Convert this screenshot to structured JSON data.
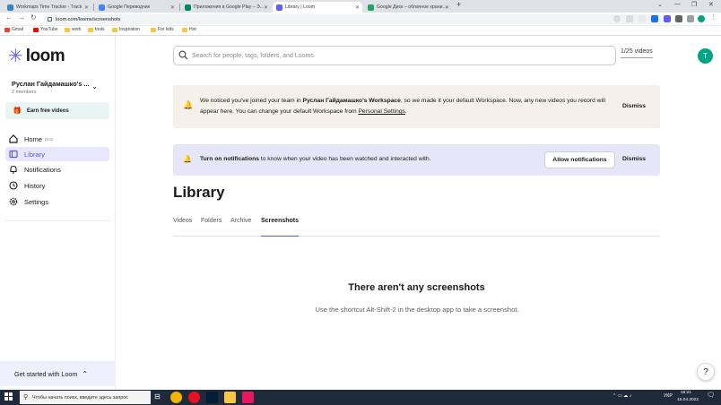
{
  "browser": {
    "tabs": [
      {
        "title": "Workmaps Time Tracker - Track",
        "color": "#3b82c4"
      },
      {
        "title": "Google Переводчик",
        "color": "#4285f4"
      },
      {
        "title": "Приложения в Google Play – Э...",
        "color": "#01875f"
      },
      {
        "title": "Library | Loom",
        "color": "#625df5"
      },
      {
        "title": "Google Диск – облачное храни...",
        "color": "#1fa463"
      }
    ],
    "new_tab": "+",
    "url": "loom.com/looms/screenshots",
    "bookmarks": [
      "Gmail",
      "YouTube",
      "work",
      "tools",
      "Inspiration",
      "For kids",
      "Hot"
    ]
  },
  "sidebar": {
    "logo_text": "loom",
    "workspace_name": "Руслан Гайдамашко's ...",
    "workspace_members": "2 members",
    "earn_label": "Earn free videos",
    "nav": [
      {
        "label": "Home",
        "badge": "Beta",
        "icon": "home-icon"
      },
      {
        "label": "Library",
        "icon": "library-icon",
        "active": true
      },
      {
        "label": "Notifications",
        "icon": "bell-icon"
      },
      {
        "label": "History",
        "icon": "clock-icon"
      },
      {
        "label": "Settings",
        "icon": "gear-icon"
      }
    ],
    "get_started": "Get started with Loom"
  },
  "header": {
    "search_placeholder": "Search for people, tags, folders, and Looms",
    "video_count": "1/25 videos",
    "avatar_letter": "T"
  },
  "banner_workspace": {
    "text_1": "We noticed you've joined your team in ",
    "workspace": "Руслан Гайдамашко's Workspace",
    "text_2": ", so we made it your default Workspace. Now, any new videos you record will appear here. You can change your default Workspace from ",
    "link": "Personal Settings",
    "text_3": ".",
    "dismiss": "Dismiss"
  },
  "banner_notifications": {
    "bold": "Turn on notifications",
    "text": " to know when your video has been watched and interacted with.",
    "allow": "Allow notifications",
    "dismiss": "Dismiss"
  },
  "library": {
    "title": "Library",
    "tabs": [
      "Videos",
      "Folders",
      "Archive",
      "Screenshots"
    ],
    "active_tab": "Screenshots",
    "empty_title": "There aren't any screenshots",
    "empty_subtitle": "Use the shortcut Alt-Shift-2 in the desktop app to take a screenshot."
  },
  "help_label": "?",
  "taskbar": {
    "search_placeholder": "Чтобы начать поиск, введите здесь запрос",
    "lang": "УКР",
    "time": "16:21",
    "date": "15.04.2022"
  },
  "colors": {
    "accent": "#565add",
    "brand": "#625df5",
    "avatar": "#00a583"
  }
}
